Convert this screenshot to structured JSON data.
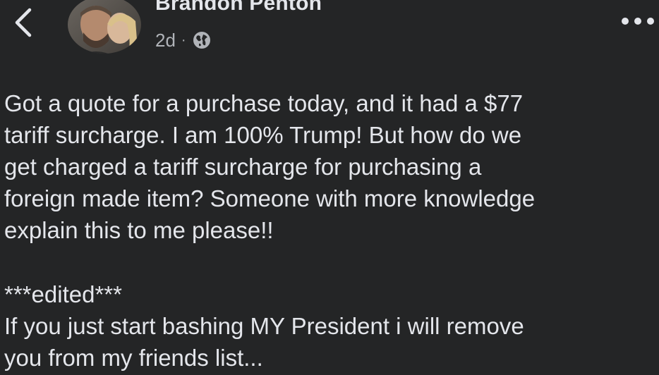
{
  "post": {
    "author": "Brandon Penton",
    "timestamp": "2d",
    "separator": "·",
    "privacy_icon": "globe-icon",
    "body": "Got a quote for a purchase today, and it had a $77\ntariff surcharge. I am 100% Trump! But how do we\nget charged a tariff surcharge for purchasing a\nforeign made item? Someone with more knowledge\nexplain this to me please!!",
    "edit_heading": "***edited***",
    "edit_body": "If you just start bashing MY President i will remove\nyou from my friends list..."
  },
  "icons": {
    "back": "back-chevron-icon",
    "more": "more-options-icon"
  },
  "colors": {
    "background": "#242526",
    "primary_text": "#e4e6eb",
    "secondary_text": "#b0b3b8"
  }
}
